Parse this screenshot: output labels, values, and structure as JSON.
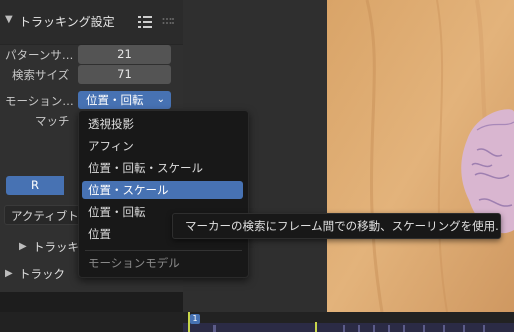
{
  "panel": {
    "title": "トラッキング設定",
    "pattern_size": {
      "label": "パターンサ…",
      "value": "21"
    },
    "search_size": {
      "label": "検索サイズ",
      "value": "71"
    },
    "motion_model": {
      "label": "モーション…",
      "value": "位置・回転"
    },
    "match_label": "マッチ",
    "channel_r": "R",
    "active_button": "アクティブト",
    "sub_tracking": "トラッキ",
    "sub_track": "トラック"
  },
  "dropdown": {
    "items": [
      "透視投影",
      "アフィン",
      "位置・回転・スケール",
      "位置・スケール",
      "位置・回転",
      "位置"
    ],
    "selected": "位置・スケール",
    "title": "モーションモデル"
  },
  "tooltip": "マーカーの検索にフレーム間での移動、スケーリングを使用.",
  "timeline": {
    "frame": "1"
  },
  "colors": {
    "accent": "#4772b3",
    "panel": "#303030",
    "menu": "#181818"
  },
  "icons": [
    "chevron-down-icon",
    "list-icon",
    "drag-handle-icon",
    "chevron-right-icon"
  ]
}
